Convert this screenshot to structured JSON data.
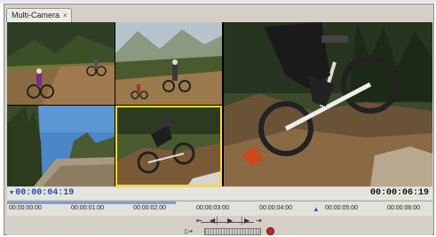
{
  "panel": {
    "tab_label": "Multi-Camera",
    "tab_close": "×"
  },
  "timecode": {
    "current": "00:00:04:19",
    "duration": "00:00:06:19"
  },
  "ruler": {
    "ticks": [
      "00:00:00:00",
      "00:00:01:00",
      "00:00:02:00",
      "00:00:03:00",
      "00:00:04:00",
      "00:00:05:00",
      "00:00:06:00"
    ]
  },
  "colors": {
    "active_camera_border": "#ffe000",
    "timecode_current": "#1a4fb0",
    "record": "#c62828"
  },
  "cameras": {
    "selected_index": 4
  },
  "icons": [
    "close-icon",
    "step-back-icon",
    "play-icon",
    "step-forward-icon",
    "goto-in-icon",
    "goto-out-icon",
    "record-icon"
  ]
}
